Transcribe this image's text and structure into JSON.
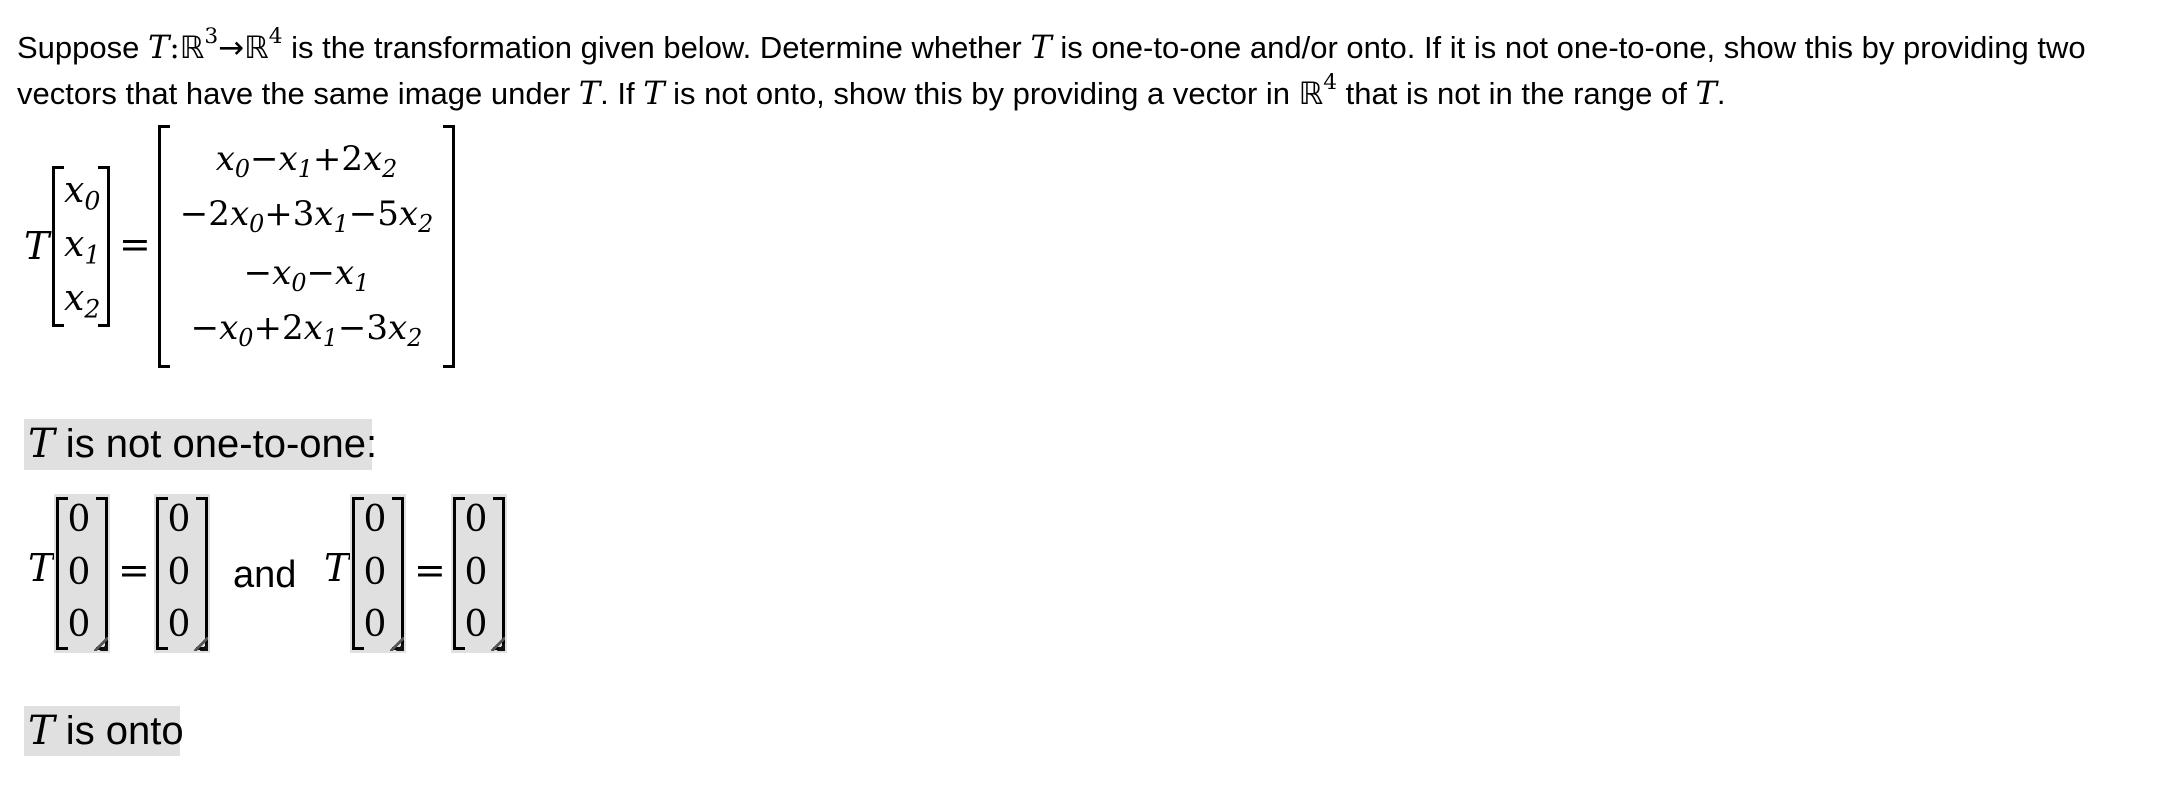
{
  "prompt": {
    "line1": {
      "pre": "Suppose ",
      "T": "T",
      "colon": ":",
      "R1": "ℝ",
      "R1_exp": "3",
      "arrow": "→",
      "R2": "ℝ",
      "R2_exp": "4",
      "mid": " is the transformation given below. Determine whether ",
      "T2": "T",
      "post": " is one-to-one and/or onto. If it is not one-to-one, show this by providing two"
    },
    "line2": {
      "pre": "vectors that have the same image under ",
      "T": "T",
      "mid1": ". If ",
      "T2": "T",
      "mid2": " is not onto, show this by providing a vector in ",
      "R": "ℝ",
      "R_exp": "4",
      "mid3": " that is not in the range of ",
      "T3": "T",
      "end": "."
    }
  },
  "definition": {
    "operator": "T",
    "equals": "=",
    "input_vector": [
      {
        "var": "x",
        "sub": "0"
      },
      {
        "var": "x",
        "sub": "1"
      },
      {
        "var": "x",
        "sub": "2"
      }
    ],
    "output_rows": [
      "x0−x1+2x2",
      "−2x0+3x1−5x2",
      "−x0−x1",
      "−x0+2x1−3x2"
    ]
  },
  "one_to_one_section": {
    "T": "T",
    "label": " is not one-to-one:",
    "connector": "and",
    "operator": "T",
    "equals": "=",
    "vector1_input": [
      "0",
      "0",
      "0"
    ],
    "vector1_output": [
      "0",
      "0",
      "0"
    ],
    "vector2_input": [
      "0",
      "0",
      "0"
    ],
    "vector2_output": [
      "0",
      "0",
      "0"
    ]
  },
  "onto_section": {
    "T": "T",
    "label": " is onto"
  },
  "colors": {
    "answer_highlight": "#e0e0e0",
    "text": "#000000"
  }
}
